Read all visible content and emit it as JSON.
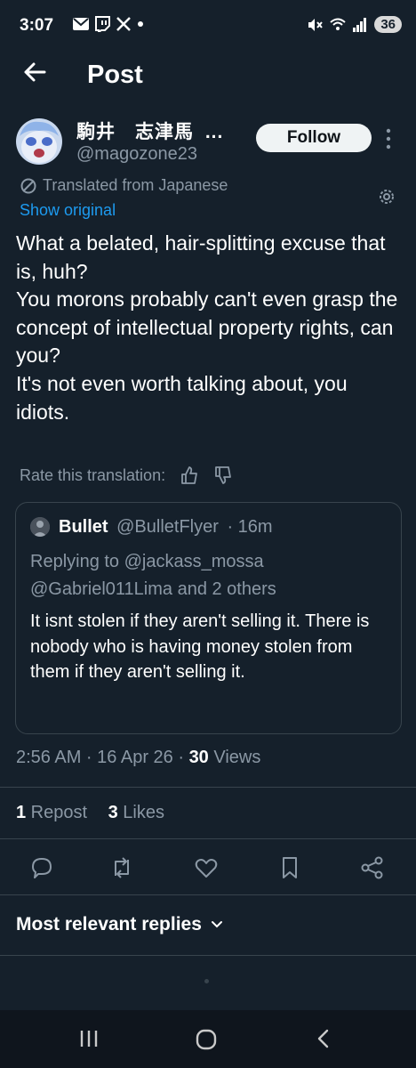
{
  "status_bar": {
    "time": "3:07",
    "battery": "36",
    "left_icons": [
      "mail-icon",
      "twitch-icon",
      "x-icon",
      "dot-icon"
    ],
    "right_icons": [
      "mute-icon",
      "wifi-icon",
      "signal-icon",
      "battery-icon"
    ]
  },
  "header": {
    "title": "Post"
  },
  "author": {
    "name": "駒井　志津馬",
    "ellipsis": "...",
    "handle": "@magozone23",
    "follow_label": "Follow"
  },
  "translation": {
    "label": "Translated from Japanese",
    "show_original": "Show original",
    "rate_label": "Rate this translation:"
  },
  "post": {
    "text": "What a belated, hair-splitting excuse that is, huh?\nYou morons probably can't even grasp the concept of intellectual property rights, can you?\nIt's not even worth talking about, you idiots."
  },
  "quote": {
    "name": "Bullet",
    "handle": "@BulletFlyer",
    "time": "· 16m",
    "replying_label": "Replying to",
    "replying_handle": "@jackass_mossa",
    "replying_rest": "@Gabriel011Lima and 2 others",
    "text": "It isnt stolen if they aren't selling it. There is nobody who is having money stolen from them if they aren't selling it."
  },
  "meta": {
    "timestamp": "2:56 AM · 16 Apr 26 · ",
    "views_count": "30",
    "views_label": " Views"
  },
  "stats": {
    "reposts_count": "1",
    "reposts_label": " Repost",
    "likes_count": "3",
    "likes_label": " Likes"
  },
  "replies": {
    "label": "Most relevant replies"
  },
  "colors": {
    "background": "#15202b",
    "accent": "#1d9bf0",
    "muted": "#8b98a5",
    "border": "#38444d"
  }
}
